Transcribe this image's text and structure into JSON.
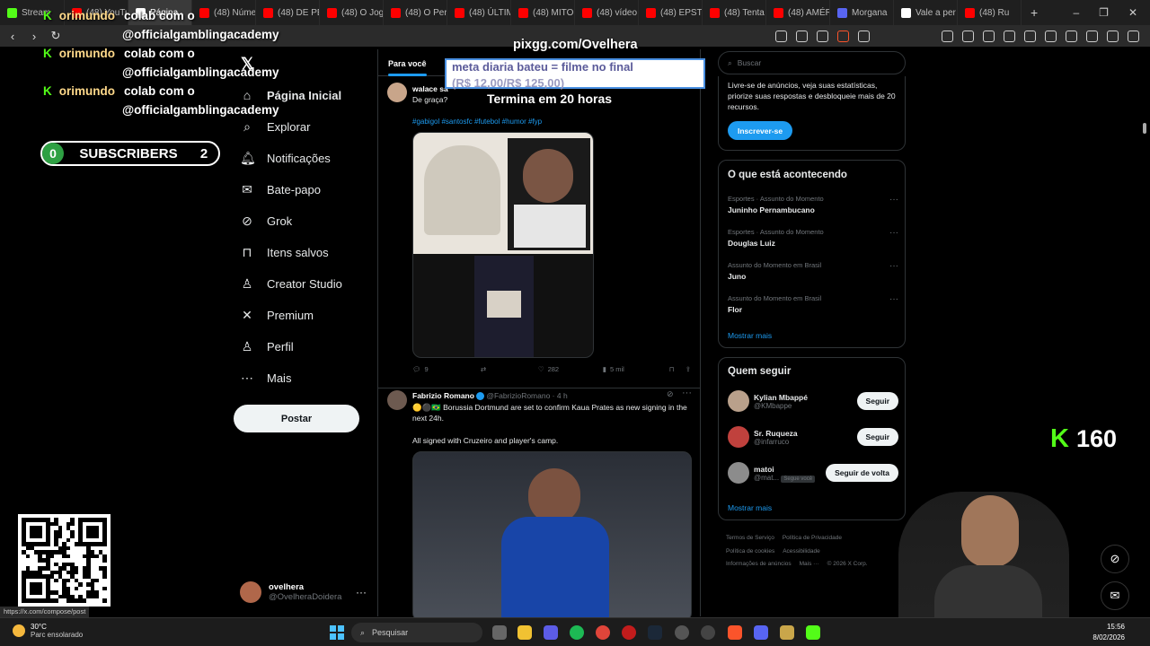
{
  "browser": {
    "tabs": [
      {
        "label": "Stream",
        "color": "#53fc18"
      },
      {
        "label": "(48) YouTub",
        "color": "#ff0000"
      },
      {
        "label": "Página",
        "color": "#ffffff",
        "active": true
      },
      {
        "label": "(48) Núme",
        "color": "#ff0000"
      },
      {
        "label": "(48) DE PE",
        "color": "#ff0000"
      },
      {
        "label": "(48) O Jog",
        "color": "#ff0000"
      },
      {
        "label": "(48) O Peri",
        "color": "#ff0000"
      },
      {
        "label": "(48) ÚLTIM",
        "color": "#ff0000"
      },
      {
        "label": "(48) MITO",
        "color": "#ff0000"
      },
      {
        "label": "(48) vídeo",
        "color": "#ff0000"
      },
      {
        "label": "(48) EPSTE",
        "color": "#ff0000"
      },
      {
        "label": "(48) Tenta",
        "color": "#ff0000"
      },
      {
        "label": "(48) AMÉR",
        "color": "#ff0000"
      },
      {
        "label": "Morgana",
        "color": "#5865f2"
      },
      {
        "label": "Vale a per",
        "color": "#ffffff"
      },
      {
        "label": "(48) Ru",
        "color": "#ff0000"
      }
    ],
    "new_tab": "+",
    "status_url": "https://x.com/compose/post"
  },
  "overlay": {
    "chat": [
      {
        "user": "orimundo",
        "line1": "colab com o",
        "line2": "@officialgamblingacademy"
      },
      {
        "user": "orimundo",
        "line1": "colab com o",
        "line2": "@officialgamblingacademy"
      },
      {
        "user": "orimundo",
        "line1": "colab com o",
        "line2": "@officialgamblingacademy"
      }
    ],
    "subs_left": "0",
    "subs_label": "SUBSCRIBERS",
    "subs_right": "2",
    "pix": "pixgg.com/Ovelhera",
    "meta_line1": "meta diaria bateu = filme no final",
    "meta_line2": "(R$ 12,00/R$ 125,00)",
    "termina": "Termina em 20 horas",
    "kick_count": "160",
    "kick_glyph": "K"
  },
  "nav": {
    "logo": "𝕏",
    "items": [
      {
        "label": "Página Inicial",
        "icon": "home-icon",
        "glyph": "⌂"
      },
      {
        "label": "Explorar",
        "icon": "search-icon",
        "glyph": "⌕"
      },
      {
        "label": "Notificações",
        "icon": "bell-icon",
        "glyph": "🔔︎"
      },
      {
        "label": "Bate-papo",
        "icon": "mail-icon",
        "glyph": "✉"
      },
      {
        "label": "Grok",
        "icon": "grok-icon",
        "glyph": "⊘"
      },
      {
        "label": "Itens salvos",
        "icon": "bookmark-icon",
        "glyph": "⊓"
      },
      {
        "label": "Creator Studio",
        "icon": "creator-icon",
        "glyph": "♙"
      },
      {
        "label": "Premium",
        "icon": "x-icon",
        "glyph": "✕"
      },
      {
        "label": "Perfil",
        "icon": "person-icon",
        "glyph": "♙"
      },
      {
        "label": "Mais",
        "icon": "more-circle-icon",
        "glyph": "⋯"
      }
    ],
    "post": "Postar",
    "account_name": "ovelhera",
    "account_handle": "@OvelheraDoidera",
    "account_more": "···"
  },
  "feed": {
    "tab_active": "Para você",
    "tweet1": {
      "name": "walace sa",
      "text": "De graça?",
      "tags": "#gabigol #santosfc #futebol #humor #fyp",
      "replies": "9",
      "likes": "282",
      "views": "5 mil"
    },
    "tweet2": {
      "name": "Fabrizio Romano",
      "handle": "@FabrizioRomano · 4 h",
      "text1": "🟡⚫🇧🇷 Borussia Dortmund are set to confirm Kaua Prates as new signing in the next 24h.",
      "text2": "All signed with Cruzeiro and player's camp."
    }
  },
  "right": {
    "search_placeholder": "Buscar",
    "premium_text": "Livre-se de anúncios, veja suas estatísticas, priorize suas respostas e desbloqueie mais de 20 recursos.",
    "premium_btn": "Inscrever-se",
    "trends_title": "O que está acontecendo",
    "trends": [
      {
        "cat": "Esportes · Assunto do Momento",
        "title": "Juninho Pernambucano"
      },
      {
        "cat": "Esportes · Assunto do Momento",
        "title": "Douglas Luiz"
      },
      {
        "cat": "Assunto do Momento em Brasil",
        "title": "Juno"
      },
      {
        "cat": "Assunto do Momento em Brasil",
        "title": "Flor"
      }
    ],
    "more": "Mostrar mais",
    "who_title": "Quem seguir",
    "who": [
      {
        "name": "Kylian Mbappé",
        "handle": "@KMbappe",
        "btn": "Seguir"
      },
      {
        "name": "Sr. Ruqueza",
        "handle": "@infarruco",
        "btn": "Seguir"
      },
      {
        "name": "matoi",
        "handle": "@mat...",
        "btn": "Seguir de volta",
        "badge": "Segue você"
      }
    ],
    "who_more": "Mostrar mais",
    "footer": [
      "Termos de Serviço",
      "Política de Privacidade",
      "Política de cookies",
      "Acessibilidade",
      "Informações de anúncios",
      "Mais ···",
      "© 2026 X Corp."
    ]
  },
  "taskbar": {
    "temp": "30°C",
    "condition": "Parc ensolarado",
    "search": "Pesquisar",
    "time": "15:56",
    "date": "8/02/2026"
  }
}
